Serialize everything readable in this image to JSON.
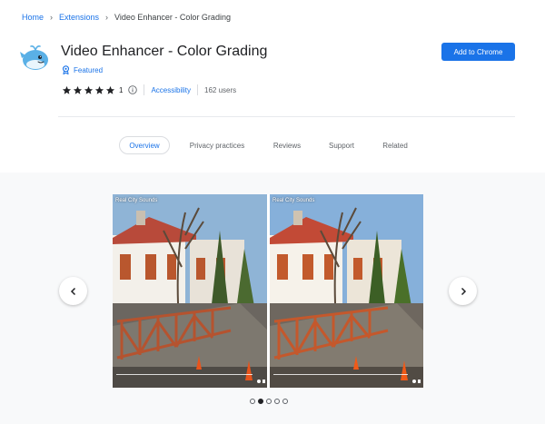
{
  "breadcrumb": {
    "home": "Home",
    "extensions": "Extensions",
    "current": "Video Enhancer - Color Grading"
  },
  "header": {
    "title": "Video Enhancer - Color Grading",
    "featured": "Featured",
    "rating": 5,
    "rating_count": "1",
    "category": "Accessibility",
    "users": "162 users",
    "add_button": "Add to Chrome"
  },
  "tabs": [
    {
      "label": "Overview",
      "active": true
    },
    {
      "label": "Privacy practices",
      "active": false
    },
    {
      "label": "Reviews",
      "active": false
    },
    {
      "label": "Support",
      "active": false
    },
    {
      "label": "Related",
      "active": false
    }
  ],
  "gallery": {
    "left_caption": "Real City Sounds",
    "right_caption": "Real City Sounds",
    "current_slide": 2,
    "total_slides": 5
  },
  "colors": {
    "accent": "#1a73e8",
    "button_text": "#ffffff",
    "gallery_bg": "#f8f9fa"
  },
  "icons": {
    "logo": "whale-logo-icon",
    "featured": "featured-badge-icon",
    "info": "info-icon",
    "prev": "chevron-left-icon",
    "next": "chevron-right-icon"
  }
}
